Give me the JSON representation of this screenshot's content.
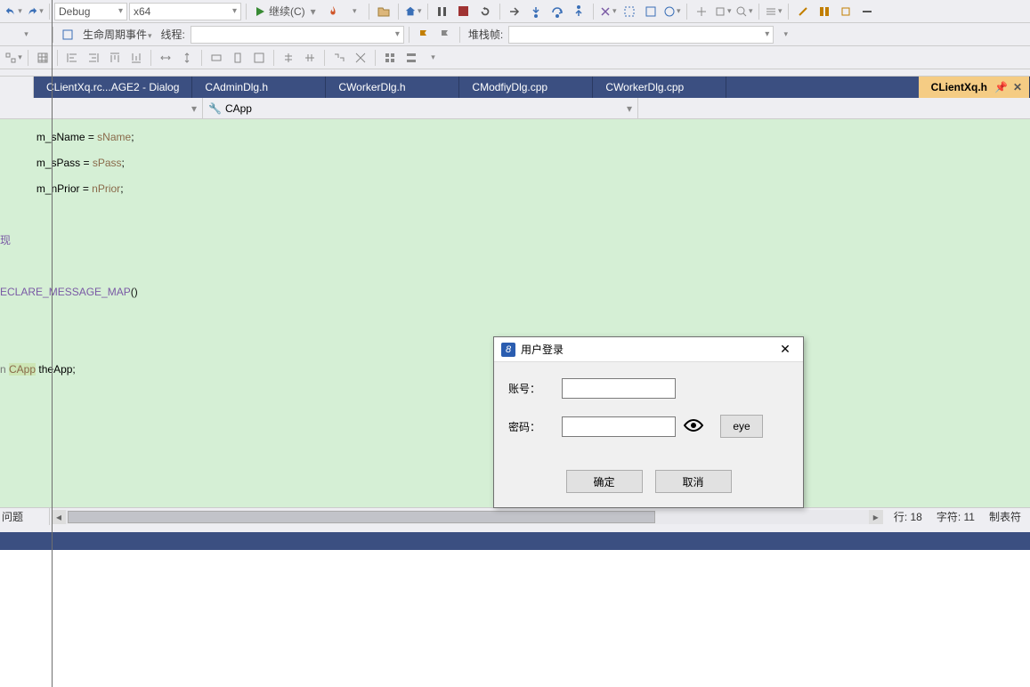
{
  "toolbar1": {
    "config": "Debug",
    "platform": "x64",
    "continue_label": "继续(C)"
  },
  "toolbar2": {
    "lifecycle_label": "生命周期事件",
    "thread_label": "线程:",
    "stackframe_label": "堆栈帧:"
  },
  "tabs": [
    {
      "label": "CLientXq.rc...AGE2 - Dialog"
    },
    {
      "label": "CAdminDlg.h"
    },
    {
      "label": "CWorkerDlg.h"
    },
    {
      "label": "CModfiyDlg.cpp"
    },
    {
      "label": "CWorkerDlg.cpp"
    },
    {
      "label": "CLientXq.h",
      "active": true
    }
  ],
  "nav": {
    "scope": "CApp"
  },
  "code": {
    "l1_a": "m_sName = ",
    "l1_b": "sName",
    "l1_c": ";",
    "l2_a": "m_sPass = ",
    "l2_b": "sPass",
    "l2_c": ";",
    "l3_a": "m_nPrior = ",
    "l3_b": "nPrior",
    "l3_c": ";",
    "l5": "现",
    "l7_a": "ECLARE_MESSAGE_MAP",
    "l7_b": "()",
    "l10_a": "n ",
    "l10_b": "CApp",
    "l10_c": " theApp;"
  },
  "bottom": {
    "issues_label": "问题",
    "line_label": "行: 18",
    "char_label": "字符: 11",
    "tab_label": "制表符"
  },
  "dialog": {
    "title": "用户登录",
    "account_label": "账号：",
    "password_label": "密码：",
    "eye_btn": "eye",
    "ok": "确定",
    "cancel": "取消"
  }
}
